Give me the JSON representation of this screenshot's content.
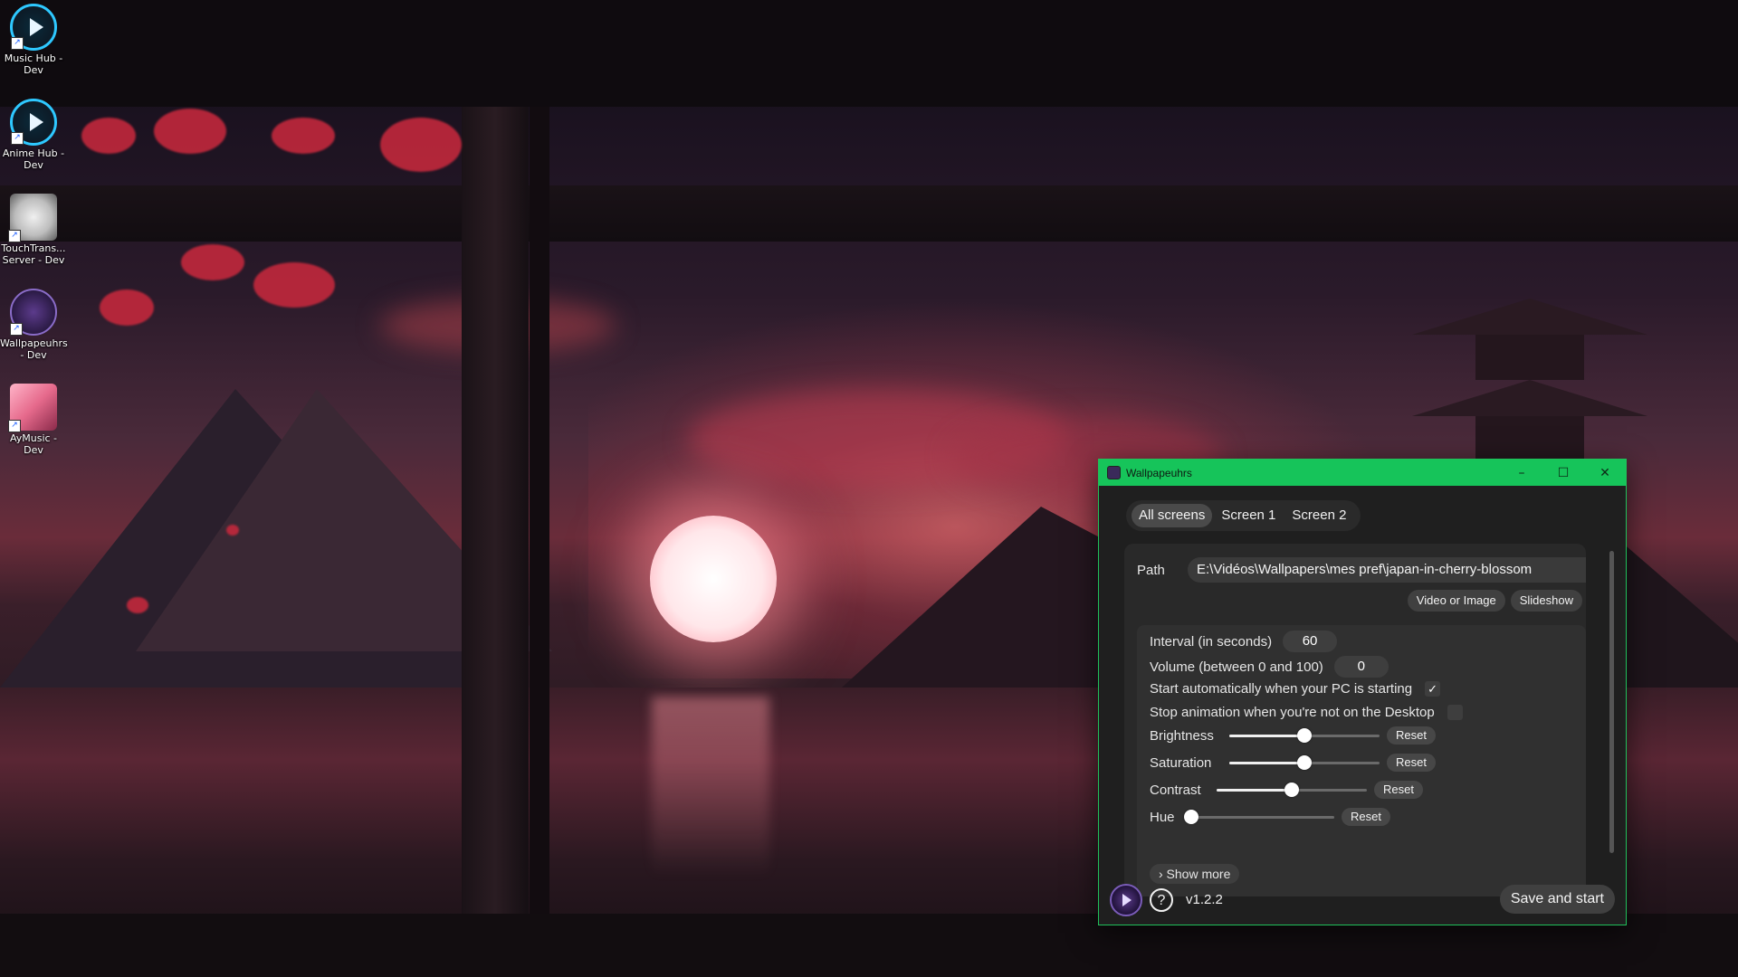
{
  "desktop": {
    "icons": [
      {
        "label": "Music Hub - Dev",
        "icon": "music-hub-play-icon"
      },
      {
        "label": "Anime Hub - Dev",
        "icon": "anime-hub-play-icon"
      },
      {
        "label": "TouchTrans... Server - Dev",
        "icon": "touchtrans-server-icon"
      },
      {
        "label": "Wallpapeuhrs - Dev",
        "icon": "wallpapeuhrs-icon"
      },
      {
        "label": "AyMusic - Dev",
        "icon": "aymusic-icon"
      }
    ]
  },
  "window": {
    "title": "Wallpapeuhrs",
    "accent": "#16c45a",
    "controls": {
      "minimize": "–",
      "maximize": "☐",
      "close": "✕"
    },
    "tabs": [
      {
        "label": "All screens",
        "active": true
      },
      {
        "label": "Screen 1",
        "active": false
      },
      {
        "label": "Screen 2",
        "active": false
      }
    ],
    "path": {
      "label": "Path",
      "value": "E:\\Vidéos\\Wallpapers\\mes pref\\japan-in-cherry-blossom"
    },
    "source_buttons": {
      "video_or_image": "Video or Image",
      "slideshow": "Slideshow"
    },
    "settings": {
      "interval": {
        "label": "Interval (in seconds)",
        "value": "60"
      },
      "volume": {
        "label": "Volume (between 0 and 100)",
        "value": "0"
      },
      "autostart": {
        "label": "Start automatically when your PC is starting",
        "checked": true,
        "mark": "✓"
      },
      "stop_anim": {
        "label": "Stop animation when you're not on the Desktop",
        "checked": false,
        "mark": ""
      },
      "brightness": {
        "label": "Brightness",
        "value": 0.5,
        "reset": "Reset"
      },
      "saturation": {
        "label": "Saturation",
        "value": 0.5,
        "reset": "Reset"
      },
      "contrast": {
        "label": "Contrast",
        "value": 0.5,
        "reset": "Reset"
      },
      "hue": {
        "label": "Hue",
        "value": 0.0,
        "reset": "Reset"
      },
      "show_more": "› Show more"
    },
    "footer": {
      "help": "?",
      "version": "v1.2.2",
      "save": "Save and start"
    }
  }
}
